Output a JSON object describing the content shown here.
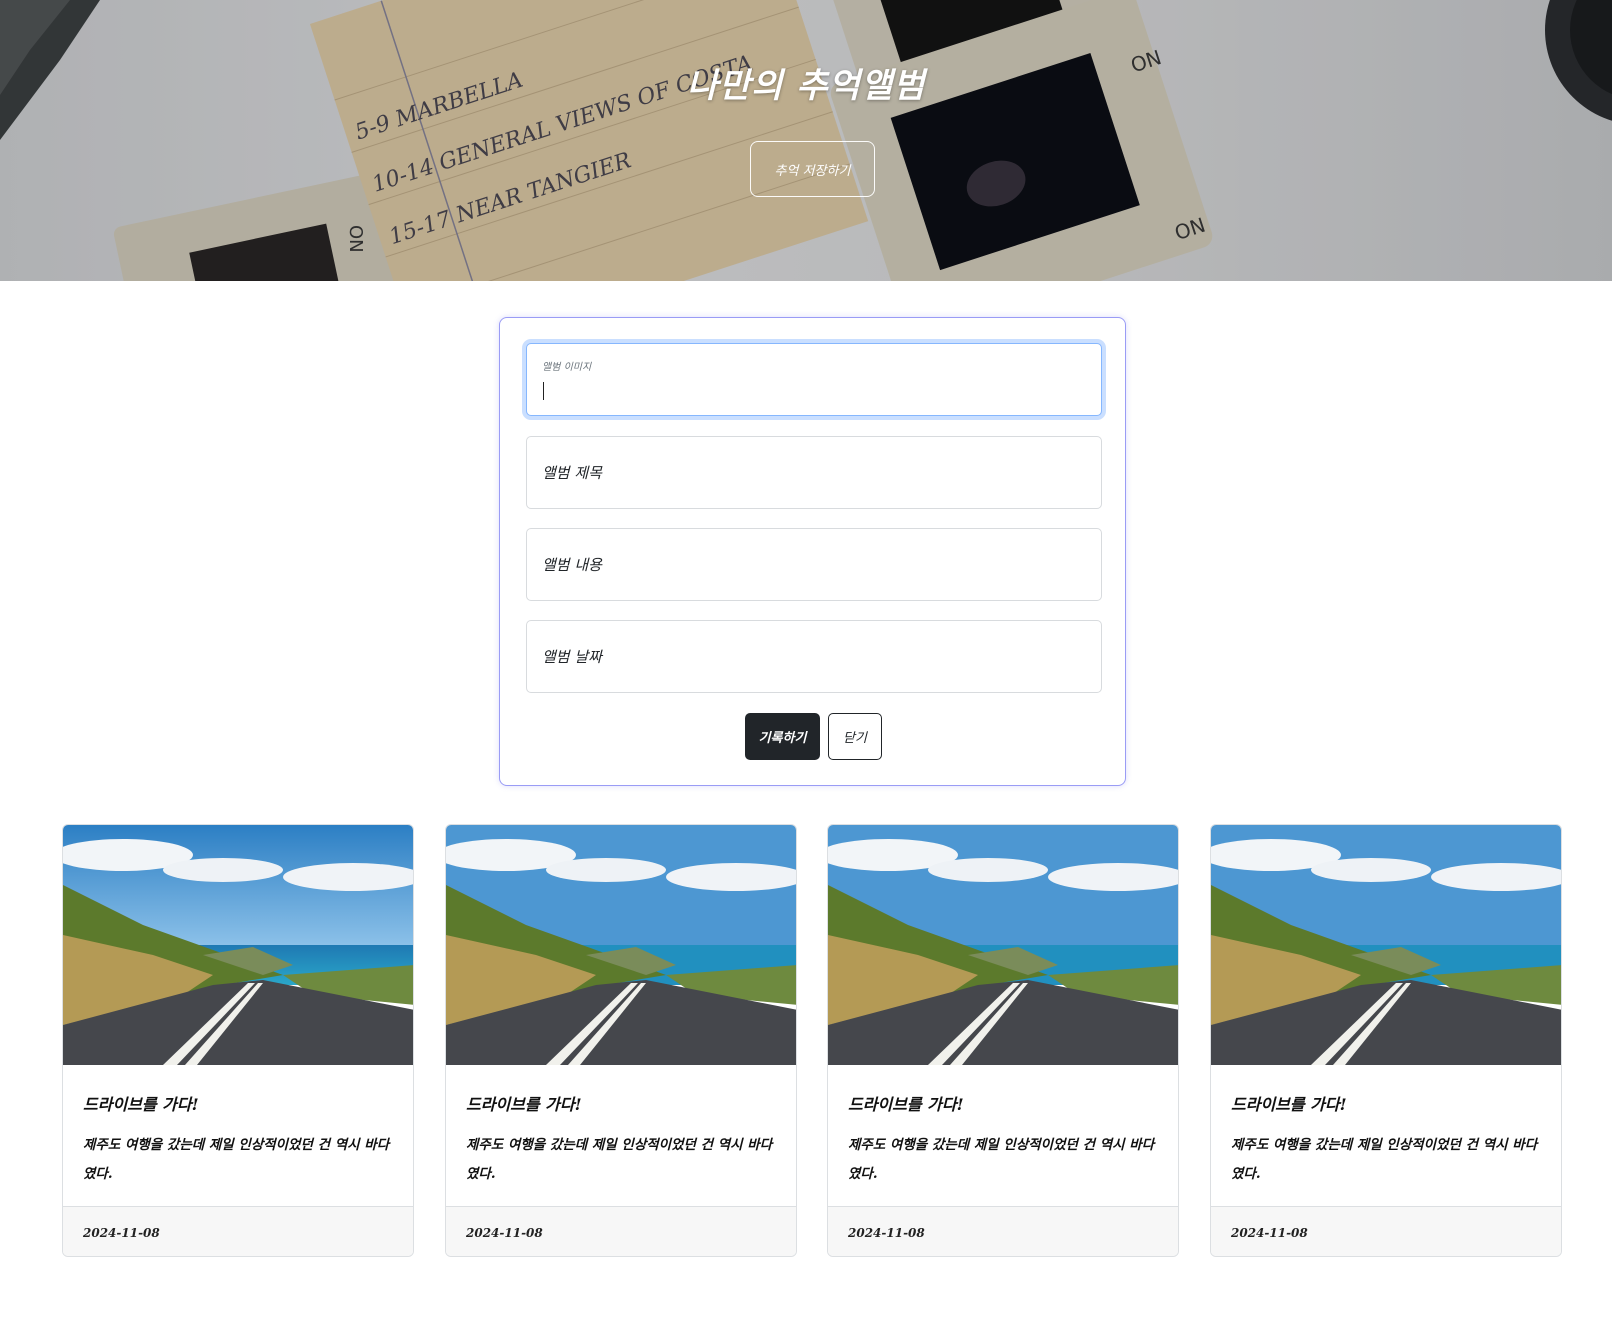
{
  "hero": {
    "title": "나만의 추억앨범",
    "save_button": "추억 저장하기"
  },
  "form": {
    "image_field": {
      "label": "앨범 이미지",
      "value": ""
    },
    "title_field": {
      "label": "앨범 제목",
      "value": ""
    },
    "content_field": {
      "label": "앨범 내용",
      "value": ""
    },
    "date_field": {
      "label": "앨범 날짜",
      "value": ""
    },
    "submit_label": "기록하기",
    "close_label": "닫기"
  },
  "cards": [
    {
      "title": "드라이브를 가다!",
      "text": "제주도 여행을 갔는데 제일 인상적이었던 건 역시 바다였다.",
      "date": "2024-11-08"
    },
    {
      "title": "드라이브를 가다!",
      "text": "제주도 여행을 갔는데 제일 인상적이었던 건 역시 바다였다.",
      "date": "2024-11-08"
    },
    {
      "title": "드라이브를 가다!",
      "text": "제주도 여행을 갔는데 제일 인상적이었던 건 역시 바다였다.",
      "date": "2024-11-08"
    },
    {
      "title": "드라이브를 가다!",
      "text": "제주도 여행을 갔는데 제일 인상적이었던 건 역시 바다였다.",
      "date": "2024-11-08"
    }
  ],
  "colors": {
    "dark_button": "#212529",
    "form_border": "#9a9cf5",
    "focus_ring": "#86b7fe"
  }
}
